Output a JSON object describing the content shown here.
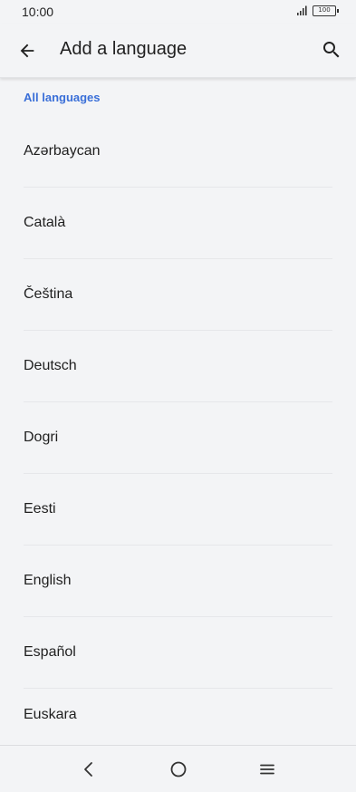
{
  "status_bar": {
    "time": "10:00",
    "battery": "100"
  },
  "app_bar": {
    "title": "Add a language",
    "back_icon": "arrow-back-icon",
    "search_icon": "search-icon"
  },
  "section": {
    "header": "All languages"
  },
  "languages": [
    "Azərbaycan",
    "Català",
    "Čeština",
    "Deutsch",
    "Dogri",
    "Eesti",
    "English",
    "Español",
    "Euskara"
  ],
  "nav_bar": {
    "back_icon": "chevron-left-icon",
    "home_icon": "circle-home-icon",
    "menu_icon": "menu-icon"
  },
  "colors": {
    "accent": "#3a6fd8",
    "background": "#f3f4f6"
  }
}
